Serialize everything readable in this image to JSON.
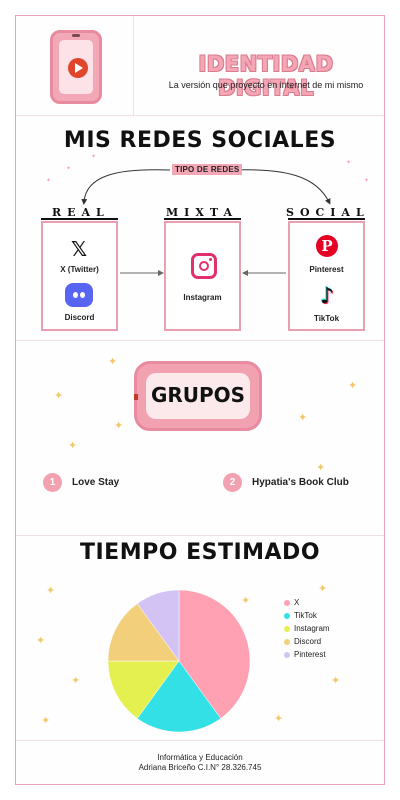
{
  "header": {
    "title": "IDENTIDAD DIGITAL",
    "subtitle": "La versión que proyecto en internet de mi mismo",
    "icon": "phone-play-icon"
  },
  "redes": {
    "heading": "MIS REDES SOCIALES",
    "tipo_label": "TIPO DE REDES",
    "categories": [
      {
        "label": "REAL",
        "items": [
          {
            "label": "X (Twitter)",
            "icon": "x-icon"
          },
          {
            "label": "Discord",
            "icon": "discord-icon"
          }
        ]
      },
      {
        "label": "MIXTA",
        "items": [
          {
            "label": "Instagram",
            "icon": "instagram-icon"
          }
        ]
      },
      {
        "label": "SOCIAL",
        "items": [
          {
            "label": "Pinterest",
            "icon": "pinterest-icon"
          },
          {
            "label": "TikTok",
            "icon": "tiktok-icon"
          }
        ]
      }
    ]
  },
  "grupos": {
    "heading": "GRUPOS",
    "items": [
      {
        "num": "1",
        "name": "Love Stay"
      },
      {
        "num": "2",
        "name": "Hypatia's Book Club"
      }
    ]
  },
  "chart_data": {
    "type": "pie",
    "title": "TIEMPO ESTIMADO",
    "labels": [
      "X",
      "TikTok",
      "Instagram",
      "Discord",
      "Pinterest"
    ],
    "values": [
      40,
      20,
      15,
      15,
      10
    ],
    "colors": [
      "#ffa1b2",
      "#33e0e6",
      "#e3f04f",
      "#f2cf7a",
      "#d3c3f5"
    ],
    "legend_position": "right"
  },
  "footer": {
    "line1": "Informática y Educación",
    "line2": "Adriana Briceño C.I.N° 28.326.745"
  },
  "colors": {
    "accent_pink": "#f2a1b0",
    "border_pink": "#e8a0b1",
    "sparkle": "#f2c86a"
  }
}
